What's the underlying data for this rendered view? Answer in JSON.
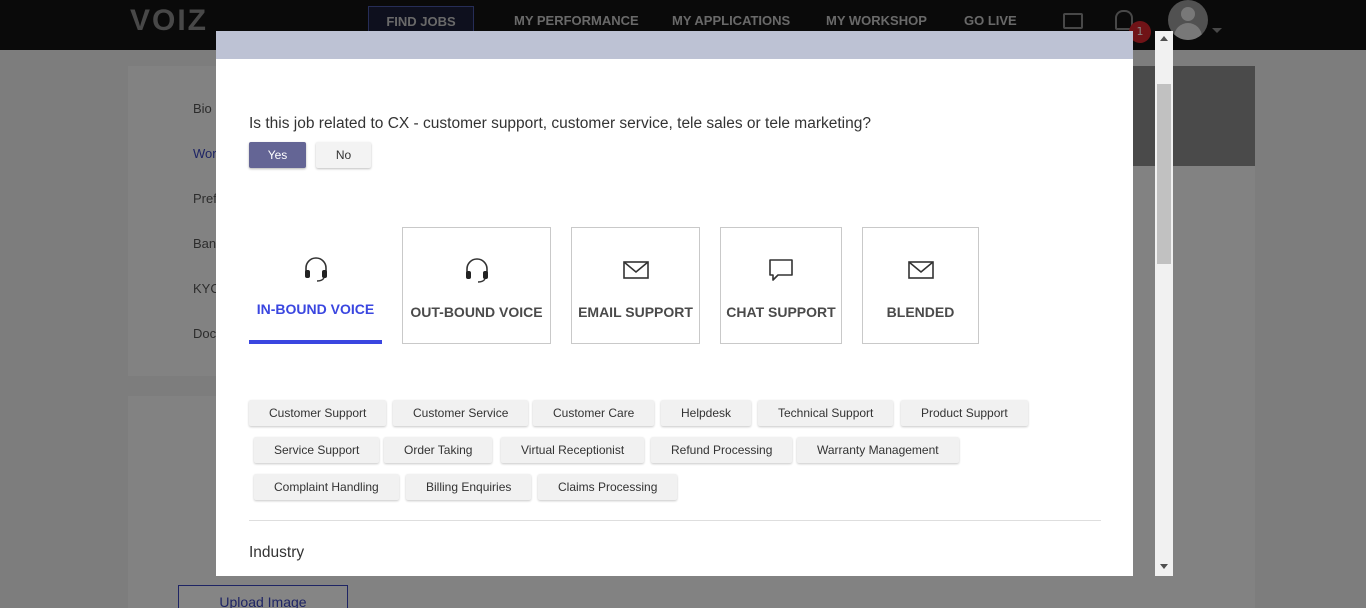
{
  "app": {
    "logo": "VOIZ"
  },
  "nav": {
    "find_jobs": "FIND JOBS",
    "my_performance": "MY PERFORMANCE",
    "my_applications": "MY APPLICATIONS",
    "my_workshop": "MY WORKSHOP",
    "go_live": "GO LIVE",
    "notification_count": "1"
  },
  "background": {
    "sidebar_items": [
      "Bio",
      "Wor",
      "Pref",
      "Bank",
      "KYC",
      "Doc"
    ],
    "upload_button": "Upload Image"
  },
  "modal": {
    "question": "Is this job related to CX - customer support, customer service, tele sales or tele marketing?",
    "yes_label": "Yes",
    "no_label": "No",
    "yes_selected": true,
    "cards": [
      {
        "label": "IN-BOUND VOICE",
        "icon": "headset-icon",
        "selected": true
      },
      {
        "label": "OUT-BOUND VOICE",
        "icon": "headset-icon",
        "selected": false
      },
      {
        "label": "EMAIL SUPPORT",
        "icon": "envelope-icon",
        "selected": false
      },
      {
        "label": "CHAT SUPPORT",
        "icon": "chat-bubble-icon",
        "selected": false
      },
      {
        "label": "BLENDED",
        "icon": "envelope-icon",
        "selected": false
      }
    ],
    "tags": [
      "Customer Support",
      "Customer Service",
      "Customer Care",
      "Helpdesk",
      "Technical Support",
      "Product Support",
      "Service Support",
      "Order Taking",
      "Virtual Receptionist",
      "Refund Processing",
      "Warranty Management",
      "Complaint Handling",
      "Billing Enquiries",
      "Claims Processing"
    ],
    "industry_heading": "Industry"
  },
  "colors": {
    "accent": "#3a46e0",
    "yes_button": "#646595",
    "modal_header": "#bdc2d4",
    "topbar": "#151515",
    "badge": "#d7262d"
  }
}
